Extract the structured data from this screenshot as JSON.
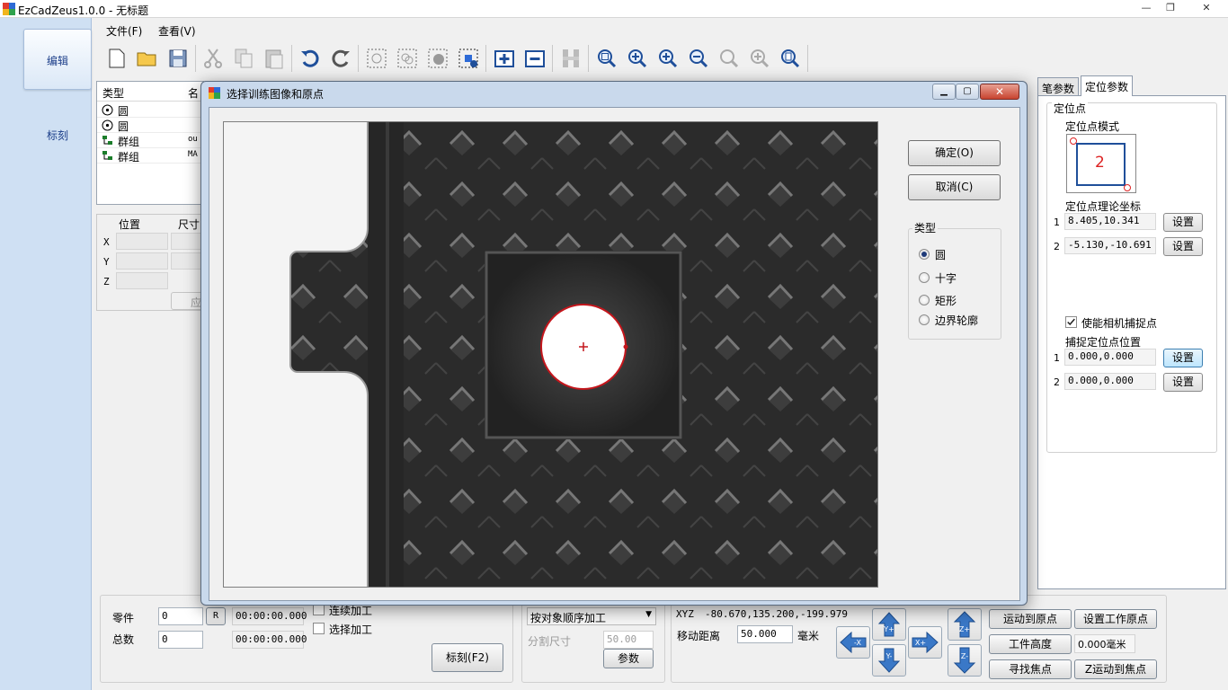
{
  "app": {
    "title": "EzCadZeus1.0.0 - 无标题"
  },
  "window_controls": {
    "minimize": "—",
    "maximize": "❐",
    "close": "✕"
  },
  "leftnav": {
    "items": [
      {
        "label": "编辑"
      },
      {
        "label": "标刻"
      }
    ]
  },
  "menu": {
    "items": [
      "文件(F)",
      "查看(V)"
    ]
  },
  "toolbar": {
    "icons": [
      "new-file-icon",
      "open-folder-icon",
      "save-icon",
      "cut-icon",
      "copy-icon",
      "paste-icon",
      "undo-icon",
      "redo-icon",
      "select-icon",
      "group-icon",
      "ungroup-icon",
      "node-icon",
      "add-icon",
      "remove-icon",
      "measure-icon",
      "zoom-all-icon",
      "zoom-in-icon",
      "zoom-in-2-icon",
      "zoom-out-icon",
      "zoom-window-icon",
      "zoom-select-icon",
      "zoom-page-icon"
    ]
  },
  "objlist": {
    "headers": [
      "类型",
      "名"
    ],
    "rows": [
      {
        "type": "圆",
        "name": "",
        "icon": "circle-icon"
      },
      {
        "type": "圆",
        "name": "",
        "icon": "circle-icon"
      },
      {
        "type": "群组",
        "name": "ou",
        "icon": "group-tree-icon"
      },
      {
        "type": "群组",
        "name": "MA",
        "icon": "group-tree-icon"
      }
    ]
  },
  "posbox": {
    "headers": [
      "位置",
      "尺寸"
    ],
    "axes": [
      "X",
      "Y",
      "Z"
    ],
    "apply": "应"
  },
  "rightpanel": {
    "tabs": [
      "笔参数",
      "定位参数"
    ],
    "group_title": "定位点",
    "mode_label": "定位点模式",
    "mode_value": "2",
    "theory_label": "定位点理论坐标",
    "theory": [
      {
        "idx": "1",
        "value": "8.405,10.341",
        "btn": "设置"
      },
      {
        "idx": "2",
        "value": "-5.130,-10.691",
        "btn": "设置"
      }
    ],
    "enable_label": "使能相机捕捉点",
    "capture_label": "捕捉定位点位置",
    "capture": [
      {
        "idx": "1",
        "value": "0.000,0.000",
        "btn": "设置"
      },
      {
        "idx": "2",
        "value": "0.000,0.000",
        "btn": "设置"
      }
    ]
  },
  "dialog": {
    "title": "选择训练图像和原点",
    "ok": "确定(O)",
    "cancel": "取消(C)",
    "type_group": "类型",
    "options": [
      {
        "label": "圆",
        "selected": true
      },
      {
        "label": "十字",
        "selected": false
      },
      {
        "label": "矩形",
        "selected": false
      },
      {
        "label": "边界轮廓",
        "selected": false
      }
    ]
  },
  "bottom": {
    "part_label": "零件",
    "part_value": "0",
    "reset": "R",
    "time1": "00:00:00.000",
    "total_label": "总数",
    "total_value": "0",
    "time2": "00:00:00.000",
    "continuous": "连续加工",
    "select_process": "选择加工",
    "mark_btn": "标刻(F2)",
    "order": "按对象顺序加工",
    "split_label": "分割尺寸",
    "split_value": "50.00",
    "param_btn": "参数",
    "xyz_label": "XYZ",
    "xyz_value": "-80.670,135.200,-199.979",
    "move_label": "移动距离",
    "move_value": "50.000",
    "move_unit": "毫米",
    "arrows": {
      "yup": "Y+",
      "ydown": "Y-",
      "xleft": "-X",
      "xright": "X+",
      "zup": "Z+",
      "zdown": "Z-"
    },
    "goto_origin": "运动到原点",
    "set_origin": "设置工作原点",
    "work_height": "工件高度",
    "height_value": "0.000毫米",
    "find_focus": "寻找焦点",
    "z_to_focus": "Z运动到焦点"
  }
}
